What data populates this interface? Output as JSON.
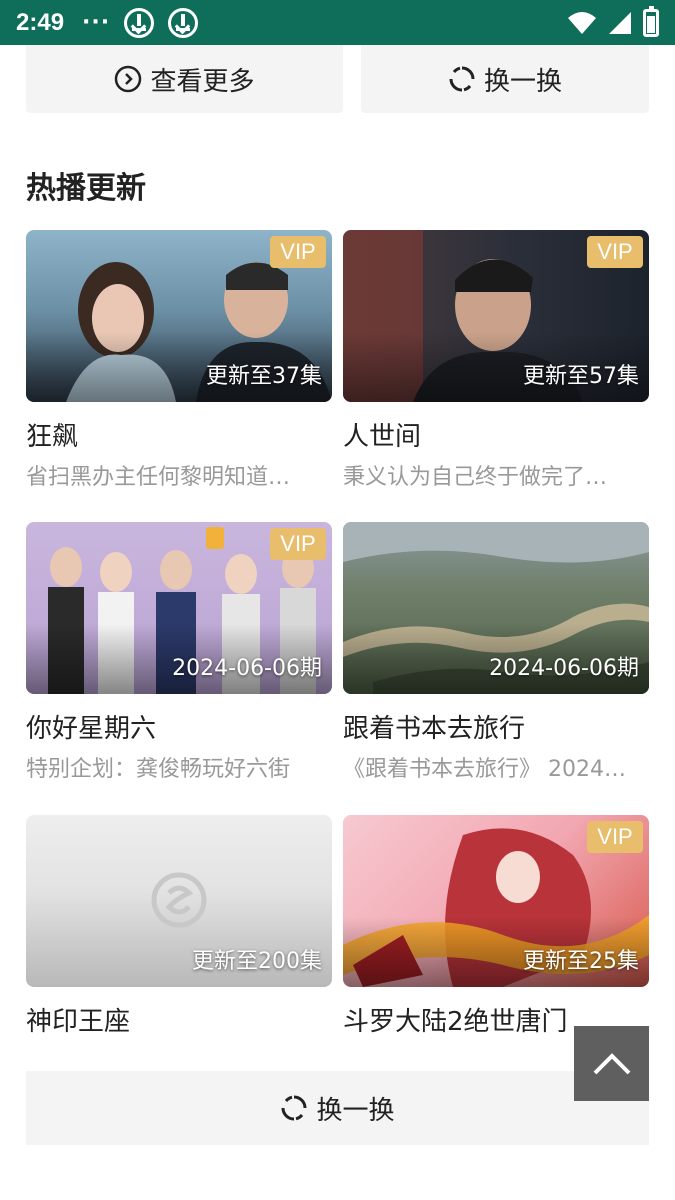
{
  "status_bar": {
    "time": "2:49",
    "overflow": "···"
  },
  "top_buttons": {
    "see_more": "查看更多",
    "refresh": "换一换"
  },
  "section": {
    "title": "热播更新"
  },
  "cards": [
    {
      "title": "狂飙",
      "desc": "省扫黑办主任何黎明知道…",
      "badge": "VIP",
      "overlay": "更新至37集"
    },
    {
      "title": "人世间",
      "desc": "秉义认为自己终于做完了…",
      "badge": "VIP",
      "overlay": "更新至57集"
    },
    {
      "title": "你好星期六",
      "desc": "特别企划：龚俊畅玩好六街",
      "badge": "VIP",
      "overlay": "2024-06-06期"
    },
    {
      "title": "跟着书本去旅行",
      "desc": "《跟着书本去旅行》 2024…",
      "badge": "",
      "overlay": "2024-06-06期"
    },
    {
      "title": "神印王座",
      "desc": "",
      "badge": "",
      "overlay": "更新至200集"
    },
    {
      "title": "斗罗大陆2绝世唐门",
      "desc": "",
      "badge": "VIP",
      "overlay": "更新至25集"
    }
  ],
  "bottom_button": {
    "refresh": "换一换"
  },
  "colors": {
    "status_bar": "#0f6e5a",
    "vip": "#e8bd6b",
    "button_bg": "#f4f4f4",
    "back_top": "#5f5f5f"
  },
  "icons": [
    "download-icon",
    "wifi-icon",
    "signal-icon",
    "battery-icon",
    "play-circle-icon",
    "refresh-icon",
    "chevron-up-icon"
  ]
}
